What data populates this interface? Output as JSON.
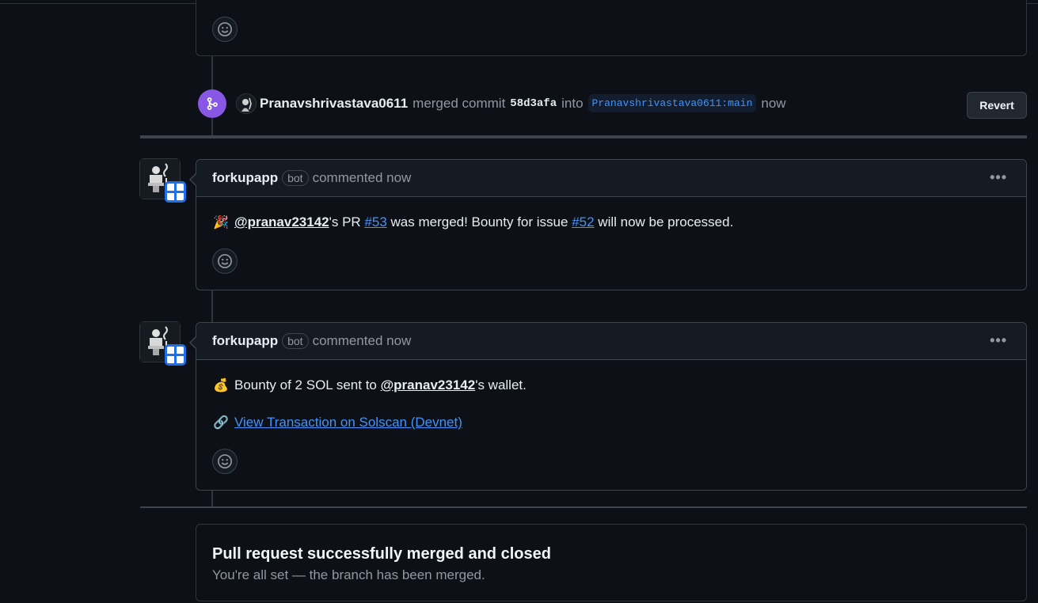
{
  "merge_event": {
    "author": "Pranavshrivastava0611",
    "action": "merged commit",
    "sha": "58d3afa",
    "into": "into",
    "branch": "Pranavshrivastava0611:main",
    "time": "now",
    "revert_label": "Revert"
  },
  "comments": [
    {
      "author": "forkupapp",
      "bot_label": "bot",
      "meta": "commented now",
      "menu": "•••",
      "lines": [
        {
          "emoji": "🎉",
          "mention": "@pranav23142",
          "text_a": "'s PR ",
          "link_a": "#53",
          "text_b": " was merged! Bounty for issue ",
          "link_b": "#52",
          "text_c": " will now be processed."
        }
      ]
    },
    {
      "author": "forkupapp",
      "bot_label": "bot",
      "meta": "commented now",
      "menu": "•••",
      "lines": [
        {
          "emoji": "💰",
          "text_a": "Bounty of 2 SOL sent to ",
          "mention": "@pranav23142",
          "text_b": "'s wallet."
        },
        {
          "emoji": "🔗",
          "link": "View Transaction on Solscan (Devnet)"
        }
      ]
    }
  ],
  "status": {
    "title": "Pull request successfully merged and closed",
    "subtitle": "You're all set — the branch has been merged."
  },
  "colors": {
    "background": "#0d1117",
    "merged_purple": "#8957e5",
    "link_blue": "#4493f8",
    "border": "#30363d"
  }
}
